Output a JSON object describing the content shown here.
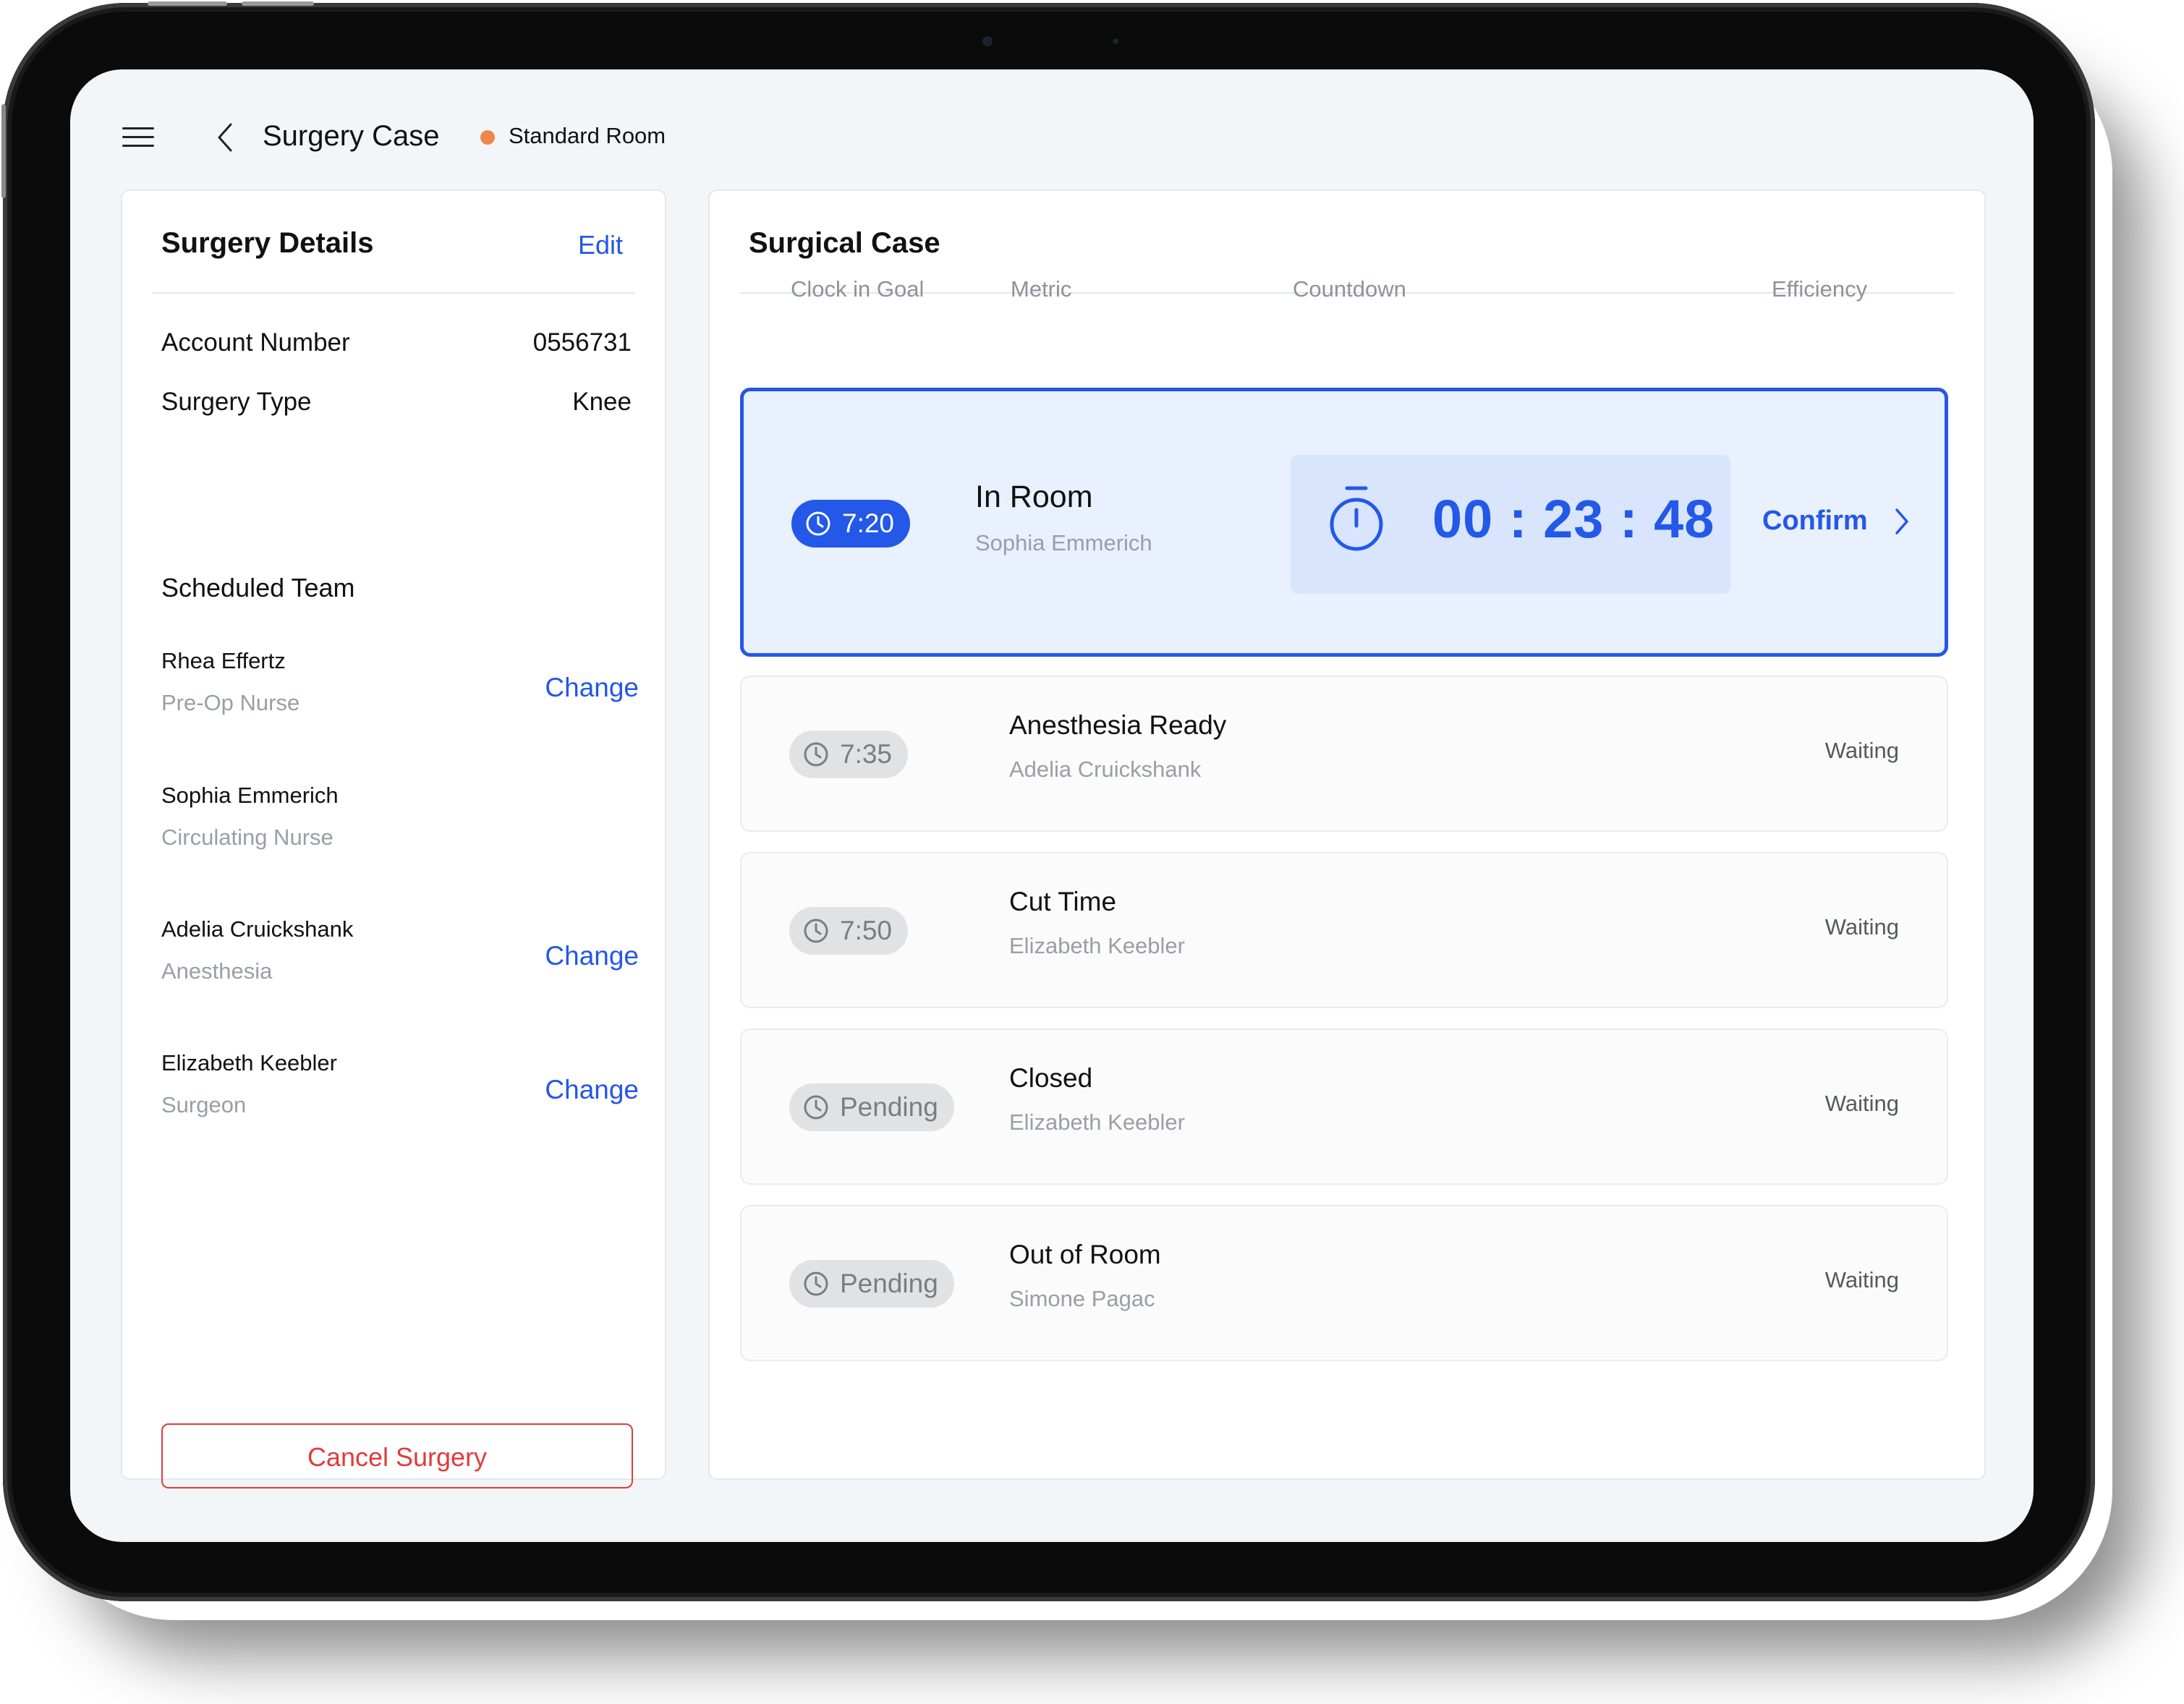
{
  "header": {
    "title": "Surgery Case",
    "room_status": "Standard Room",
    "room_status_color": "#f0874a"
  },
  "details": {
    "title": "Surgery Details",
    "edit_label": "Edit",
    "account_label": "Account Number",
    "account_value": "0556731",
    "type_label": "Surgery Type",
    "type_value": "Knee",
    "team_heading": "Scheduled Team",
    "team": [
      {
        "name": "Rhea Effertz",
        "role": "Pre-Op Nurse",
        "action": "Change"
      },
      {
        "name": "Sophia Emmerich",
        "role": "Circulating Nurse",
        "action": ""
      },
      {
        "name": "Adelia Cruickshank",
        "role": "Anesthesia",
        "action": "Change"
      },
      {
        "name": "Elizabeth Keebler",
        "role": "Surgeon",
        "action": "Change"
      }
    ],
    "cancel_label": "Cancel Surgery"
  },
  "surgical_case": {
    "title": "Surgical Case",
    "columns": [
      "Clock in Goal",
      "Metric",
      "Countdown",
      "Efficiency"
    ],
    "active": {
      "goal": "7:20",
      "metric": "In Room",
      "person": "Sophia Emmerich",
      "countdown": "00 : 23 : 48",
      "action": "Confirm"
    },
    "rows": [
      {
        "goal": "7:35",
        "metric": "Anesthesia Ready",
        "person": "Adelia Cruickshank",
        "status": "Waiting"
      },
      {
        "goal": "7:50",
        "metric": "Cut Time",
        "person": "Elizabeth Keebler",
        "status": "Waiting"
      },
      {
        "goal": "Pending",
        "metric": "Closed",
        "person": "Elizabeth Keebler",
        "status": "Waiting"
      },
      {
        "goal": "Pending",
        "metric": "Out of Room",
        "person": "Simone Pagac",
        "status": "Waiting"
      }
    ]
  },
  "icons": [
    "menu-icon",
    "chevron-left-icon",
    "clock-icon",
    "stopwatch-icon",
    "chevron-right-icon"
  ],
  "colors": {
    "accent": "#2358e8",
    "danger": "#e23b3b",
    "active_bg": "#e9f0fe"
  }
}
